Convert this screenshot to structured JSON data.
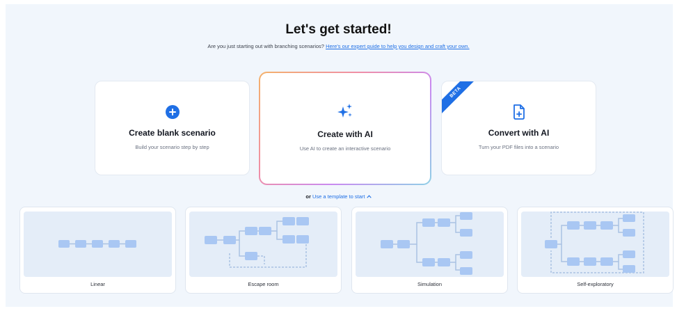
{
  "header": {
    "title": "Let's get started!",
    "subtitle_prefix": "Are you just starting out with branching scenarios? ",
    "guide_link": "Here's our expert guide to help you design and craft your own."
  },
  "cards": {
    "blank": {
      "icon": "plus-circle-icon",
      "title": "Create blank scenario",
      "description": "Build your scenario step by step"
    },
    "ai": {
      "icon": "sparkles-icon",
      "title": "Create with AI",
      "description": "Use AI to create an interactive scenario"
    },
    "convert": {
      "icon": "document-plus-icon",
      "badge": "BETA",
      "title": "Convert with AI",
      "description": "Turn your PDF files into a scenario"
    }
  },
  "templates": {
    "prefix": "or",
    "link": "Use a template to start",
    "items": [
      {
        "label": "Linear"
      },
      {
        "label": "Escape room"
      },
      {
        "label": "Simulation"
      },
      {
        "label": "Self-exploratory"
      }
    ]
  },
  "colors": {
    "accent": "#1f6fe5",
    "node": "#a9c7f3",
    "connector": "#a9c2e2"
  }
}
